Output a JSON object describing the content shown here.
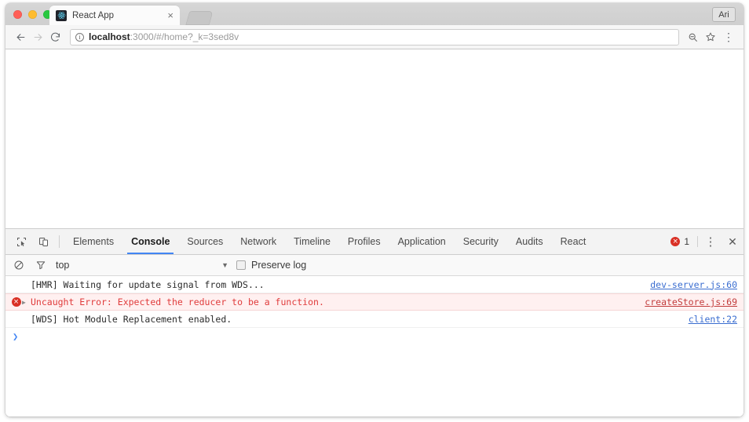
{
  "window": {
    "traffic_lights": [
      "close",
      "minimize",
      "zoom"
    ]
  },
  "tab": {
    "title": "React App",
    "favicon": "react-logo-icon",
    "close_label": "×"
  },
  "profile": {
    "label": "Ari"
  },
  "nav": {
    "back": "←",
    "forward": "→",
    "reload": "⟳",
    "info_icon": "i",
    "url_host": "localhost",
    "url_rest": ":3000/#/home?_k=3sed8v",
    "zoom_icon": "zoom-icon",
    "bookmark_icon": "☆",
    "menu_icon": "⋮"
  },
  "devtools": {
    "inspect_icon": "inspect-element-icon",
    "device_icon": "device-toolbar-icon",
    "tabs": [
      {
        "label": "Elements",
        "active": false
      },
      {
        "label": "Console",
        "active": true
      },
      {
        "label": "Sources",
        "active": false
      },
      {
        "label": "Network",
        "active": false
      },
      {
        "label": "Timeline",
        "active": false
      },
      {
        "label": "Profiles",
        "active": false
      },
      {
        "label": "Application",
        "active": false
      },
      {
        "label": "Security",
        "active": false
      },
      {
        "label": "Audits",
        "active": false
      },
      {
        "label": "React",
        "active": false
      }
    ],
    "error_count": "1",
    "error_glyph": "×",
    "more_icon": "⋮",
    "close_icon": "✕",
    "accent_color": "#4285f4",
    "error_color": "#d93025"
  },
  "filterbar": {
    "clear_icon": "clear-console-icon",
    "filter_icon": "filter-icon",
    "context": "top",
    "caret": "▼",
    "preserve_log_label": "Preserve log",
    "preserve_log_checked": false
  },
  "console": {
    "messages": [
      {
        "level": "log",
        "text": "[HMR] Waiting for update signal from WDS...",
        "source": "dev-server.js:60",
        "expandable": false
      },
      {
        "level": "error",
        "text": "Uncaught Error: Expected the reducer to be a function.",
        "source": "createStore.js:69",
        "expandable": true,
        "triangle": "▶"
      },
      {
        "level": "log",
        "text": "[WDS] Hot Module Replacement enabled.",
        "source": "client:22",
        "expandable": false
      }
    ],
    "prompt": "❯"
  }
}
